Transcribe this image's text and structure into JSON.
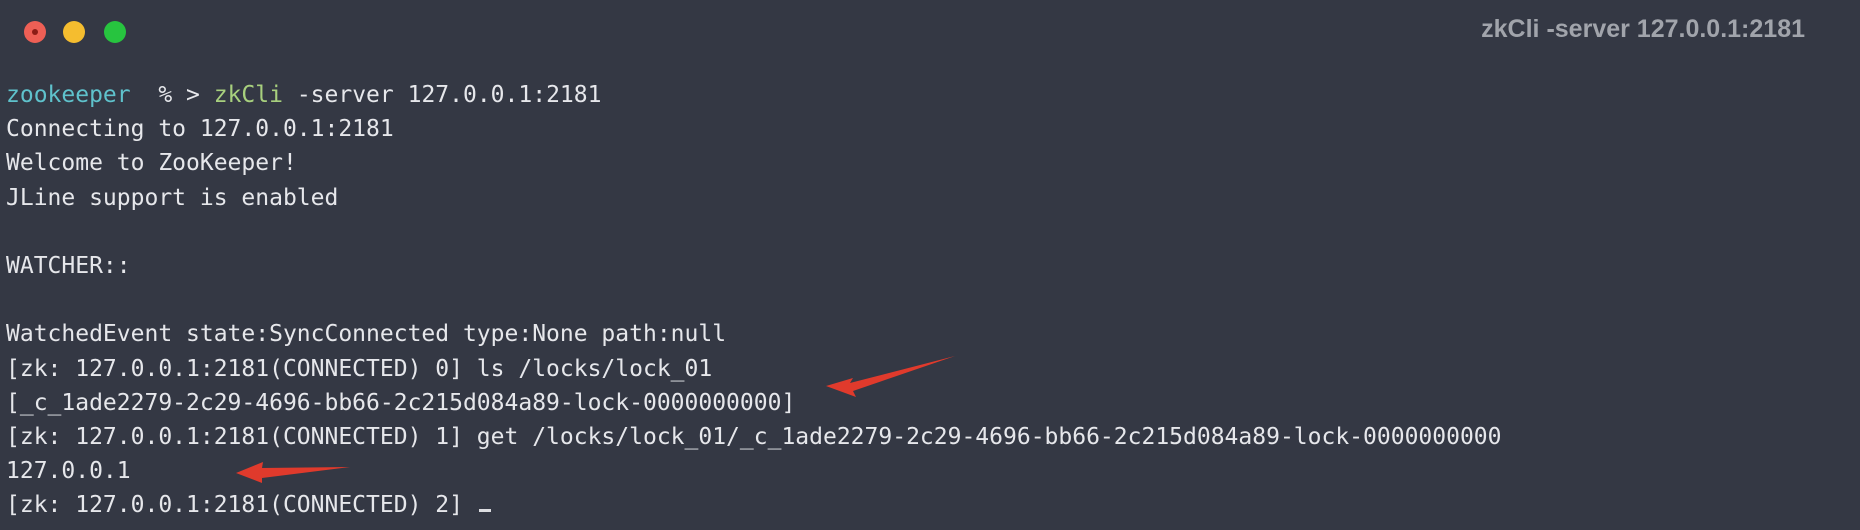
{
  "window": {
    "title": "zkCli -server 127.0.0.1:2181"
  },
  "terminal": {
    "prompt": {
      "user": "zookeeper",
      "symbols": "  % > ",
      "command": "zkCli",
      "args": " -server 127.0.0.1:2181"
    },
    "lines": [
      "Connecting to 127.0.0.1:2181",
      "Welcome to ZooKeeper!",
      "JLine support is enabled",
      "",
      "WATCHER::",
      "",
      "WatchedEvent state:SyncConnected type:None path:null",
      "[zk: 127.0.0.1:2181(CONNECTED) 0] ls /locks/lock_01",
      "[_c_1ade2279-2c29-4696-bb66-2c215d084a89-lock-0000000000]",
      "[zk: 127.0.0.1:2181(CONNECTED) 1] get /locks/lock_01/_c_1ade2279-2c29-4696-bb66-2c215d084a89-lock-0000000000",
      "127.0.0.1"
    ],
    "current_prompt": "[zk: 127.0.0.1:2181(CONNECTED) 2] "
  },
  "colors": {
    "background": "#343844",
    "annotation_arrow": "#e03a2c"
  },
  "icons": [
    "close-icon",
    "minimize-icon",
    "maximize-icon",
    "arrow-annotation"
  ]
}
